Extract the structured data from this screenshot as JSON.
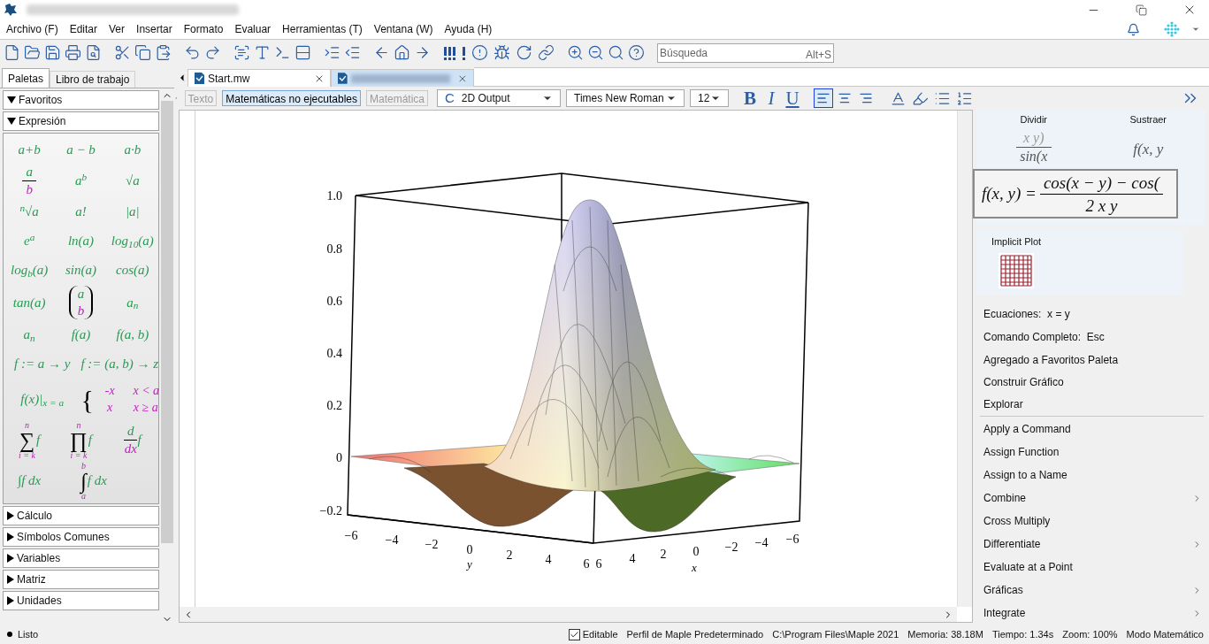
{
  "menu": [
    "Archivo (F)",
    "Editar",
    "Ver",
    "Insertar",
    "Formato",
    "Evaluar",
    "Herramientas (T)",
    "Ventana (W)",
    "Ayuda (H)"
  ],
  "search": {
    "placeholder": "Búsqueda",
    "shortcut": "Alt+S"
  },
  "left_panel": {
    "tabs": [
      {
        "label": "Paletas",
        "selected": true
      },
      {
        "label": "Libro de trabajo",
        "selected": false
      }
    ],
    "sections": [
      {
        "title": "Favoritos",
        "expanded": true
      },
      {
        "title": "Expresión",
        "expanded": true,
        "items": [
          {
            "kind": "text",
            "text": "a+b"
          },
          {
            "kind": "text",
            "text": "a − b"
          },
          {
            "kind": "text",
            "text": "a·b"
          },
          {
            "kind": "fraction",
            "num": "a",
            "den": "b"
          },
          {
            "kind": "text",
            "text": "a$^{b}$"
          },
          {
            "kind": "text",
            "text": "√a"
          },
          {
            "kind": "text",
            "text": "$^{n}$√a"
          },
          {
            "kind": "text",
            "text": "a!"
          },
          {
            "kind": "text",
            "text": "|a|"
          },
          {
            "kind": "text",
            "text": "e$^{a}$"
          },
          {
            "kind": "text",
            "text": "ln(a)"
          },
          {
            "kind": "text",
            "text": "log$_{10}$(a)"
          },
          {
            "kind": "text",
            "text": "log$_{b}$(a)"
          },
          {
            "kind": "text",
            "text": "sin(a)"
          },
          {
            "kind": "text",
            "text": "cos(a)"
          },
          {
            "kind": "text",
            "text": "tan(a)"
          },
          {
            "kind": "vector",
            "top": "a",
            "bottom": "b"
          },
          {
            "kind": "text",
            "text": "a$_{n}$"
          },
          {
            "kind": "text",
            "text": "a$_{n}$"
          },
          {
            "kind": "text",
            "text": "f(a)"
          },
          {
            "kind": "text",
            "text": "f(a, b)"
          },
          {
            "kind": "text",
            "text": "f := a → y"
          },
          {
            "kind": "text",
            "text": "f := (a, b) → z"
          },
          {
            "kind": "text",
            "text": "f(x)|$_{x = a}$"
          },
          {
            "kind": "piecewise",
            "brace": "{",
            "rows": [
              [
                "-x",
                "x < a"
              ],
              [
                "x",
                "x ≥ a"
              ]
            ]
          },
          {
            "kind": "bigop",
            "symbol": "∑",
            "top": "n",
            "bottom": "i = k",
            "body": "f"
          },
          {
            "kind": "bigop",
            "symbol": "∏",
            "top": "n",
            "bottom": "i = k",
            "body": "f"
          },
          {
            "kind": "fraction",
            "num": "d",
            "den": "dx",
            "after": "f"
          },
          {
            "kind": "text",
            "text": "∫f dx"
          },
          {
            "kind": "bigop",
            "symbol": "∫",
            "top": "b",
            "bottom": "a",
            "body": "f dx"
          }
        ]
      },
      {
        "title": "Cálculo",
        "expanded": false
      },
      {
        "title": "Símbolos Comunes",
        "expanded": false
      },
      {
        "title": "Variables",
        "expanded": false
      },
      {
        "title": "Matriz",
        "expanded": false
      },
      {
        "title": "Unidades",
        "expanded": false
      }
    ]
  },
  "document_tabs": [
    {
      "label": "Start.mw",
      "selected": false
    },
    {
      "selected": true
    }
  ],
  "format_bar": {
    "modes": [
      {
        "label": "Texto",
        "selected": false
      },
      {
        "label": "Matemáticas no ejecutables",
        "selected": true
      },
      {
        "label": "Matemática",
        "selected": false
      }
    ],
    "style_glyph": "C",
    "style": "2D Output",
    "font": "Times New Roman",
    "size": "12",
    "text_styles": [
      "B",
      "I",
      "U"
    ],
    "alignments": [
      {
        "selected": true
      },
      {
        "selected": false
      },
      {
        "selected": false
      }
    ]
  },
  "plot": {
    "z_ticks": [
      "1.0",
      "0.8",
      "0.6",
      "0.4",
      "0.2",
      "0",
      "−0.2"
    ],
    "y_ticks": [
      "−6",
      "−4",
      "−2",
      "0",
      "2",
      "4",
      "6"
    ],
    "x_ticks": [
      "6",
      "4",
      "2",
      "0",
      "−2",
      "−4",
      "−6"
    ],
    "y_label": "y",
    "x_label": "x"
  },
  "context_panel": {
    "tiles": [
      {
        "title": "Dividir",
        "num": "x y)",
        "den": "sin(x"
      },
      {
        "title": "Sustraer",
        "num": "f(x, y"
      }
    ],
    "formula": {
      "lhs": "f(x, y) =",
      "num": "cos(x − y) − cos(",
      "den": "2 x y"
    },
    "plot_tile": {
      "title": "Implicit Plot"
    },
    "hints": [
      {
        "label": "Ecuaciones:",
        "value": "x = y"
      },
      {
        "label": "Comando Completo:",
        "value": "Esc"
      }
    ],
    "actions": [
      "Agregado a Favoritos Paleta",
      "Construir Gráfico",
      "Explorar"
    ],
    "commands": [
      {
        "label": "Apply a Command",
        "submenu": false
      },
      {
        "label": "Assign Function",
        "submenu": false
      },
      {
        "label": "Assign to a Name",
        "submenu": false
      },
      {
        "label": "Combine",
        "submenu": true
      },
      {
        "label": "Cross Multiply",
        "submenu": false
      },
      {
        "label": "Differentiate",
        "submenu": true
      },
      {
        "label": "Evaluate at a Point",
        "submenu": false
      },
      {
        "label": "Gráficas",
        "submenu": true
      },
      {
        "label": "Integrate",
        "submenu": true
      }
    ]
  },
  "status_bar": {
    "status": "Listo",
    "editable": {
      "label": "Editable",
      "checked": true
    },
    "items": [
      "Perfil de Maple Predeterminado",
      "C:\\Program Files\\Maple 2021",
      "Memoria: 38.18M",
      "Tiempo: 1.34s",
      "Zoom: 100%",
      "Modo Matemático"
    ]
  }
}
